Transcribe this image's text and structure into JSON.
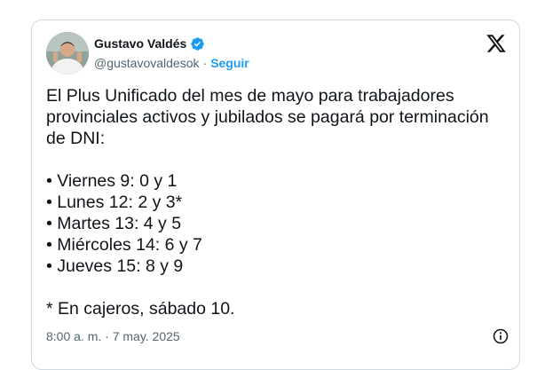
{
  "author": {
    "name": "Gustavo Valdés",
    "handle": "@gustavovaldesok",
    "separator": "·",
    "follow_label": "Seguir"
  },
  "tweet": {
    "lines": [
      "El Plus Unificado del mes de mayo para trabajadores",
      "provinciales activos y jubilados se pagará por terminación",
      "de DNI:",
      "",
      "• Viernes 9: 0 y 1",
      "• Lunes 12: 2 y 3*",
      "• Martes 13: 4 y 5",
      "• Miércoles 14: 6 y 7",
      "• Jueves 15: 8 y 9",
      "",
      "* En cajeros, sábado 10."
    ],
    "timestamp": "8:00 a. m. · 7 may. 2025"
  },
  "icons": {
    "verified": "verified-badge-icon",
    "logo": "x-logo-icon",
    "info": "info-icon"
  },
  "colors": {
    "text": "#0f1419",
    "secondary": "#536471",
    "accent": "#1d9bf0",
    "border": "#cfd9de"
  }
}
